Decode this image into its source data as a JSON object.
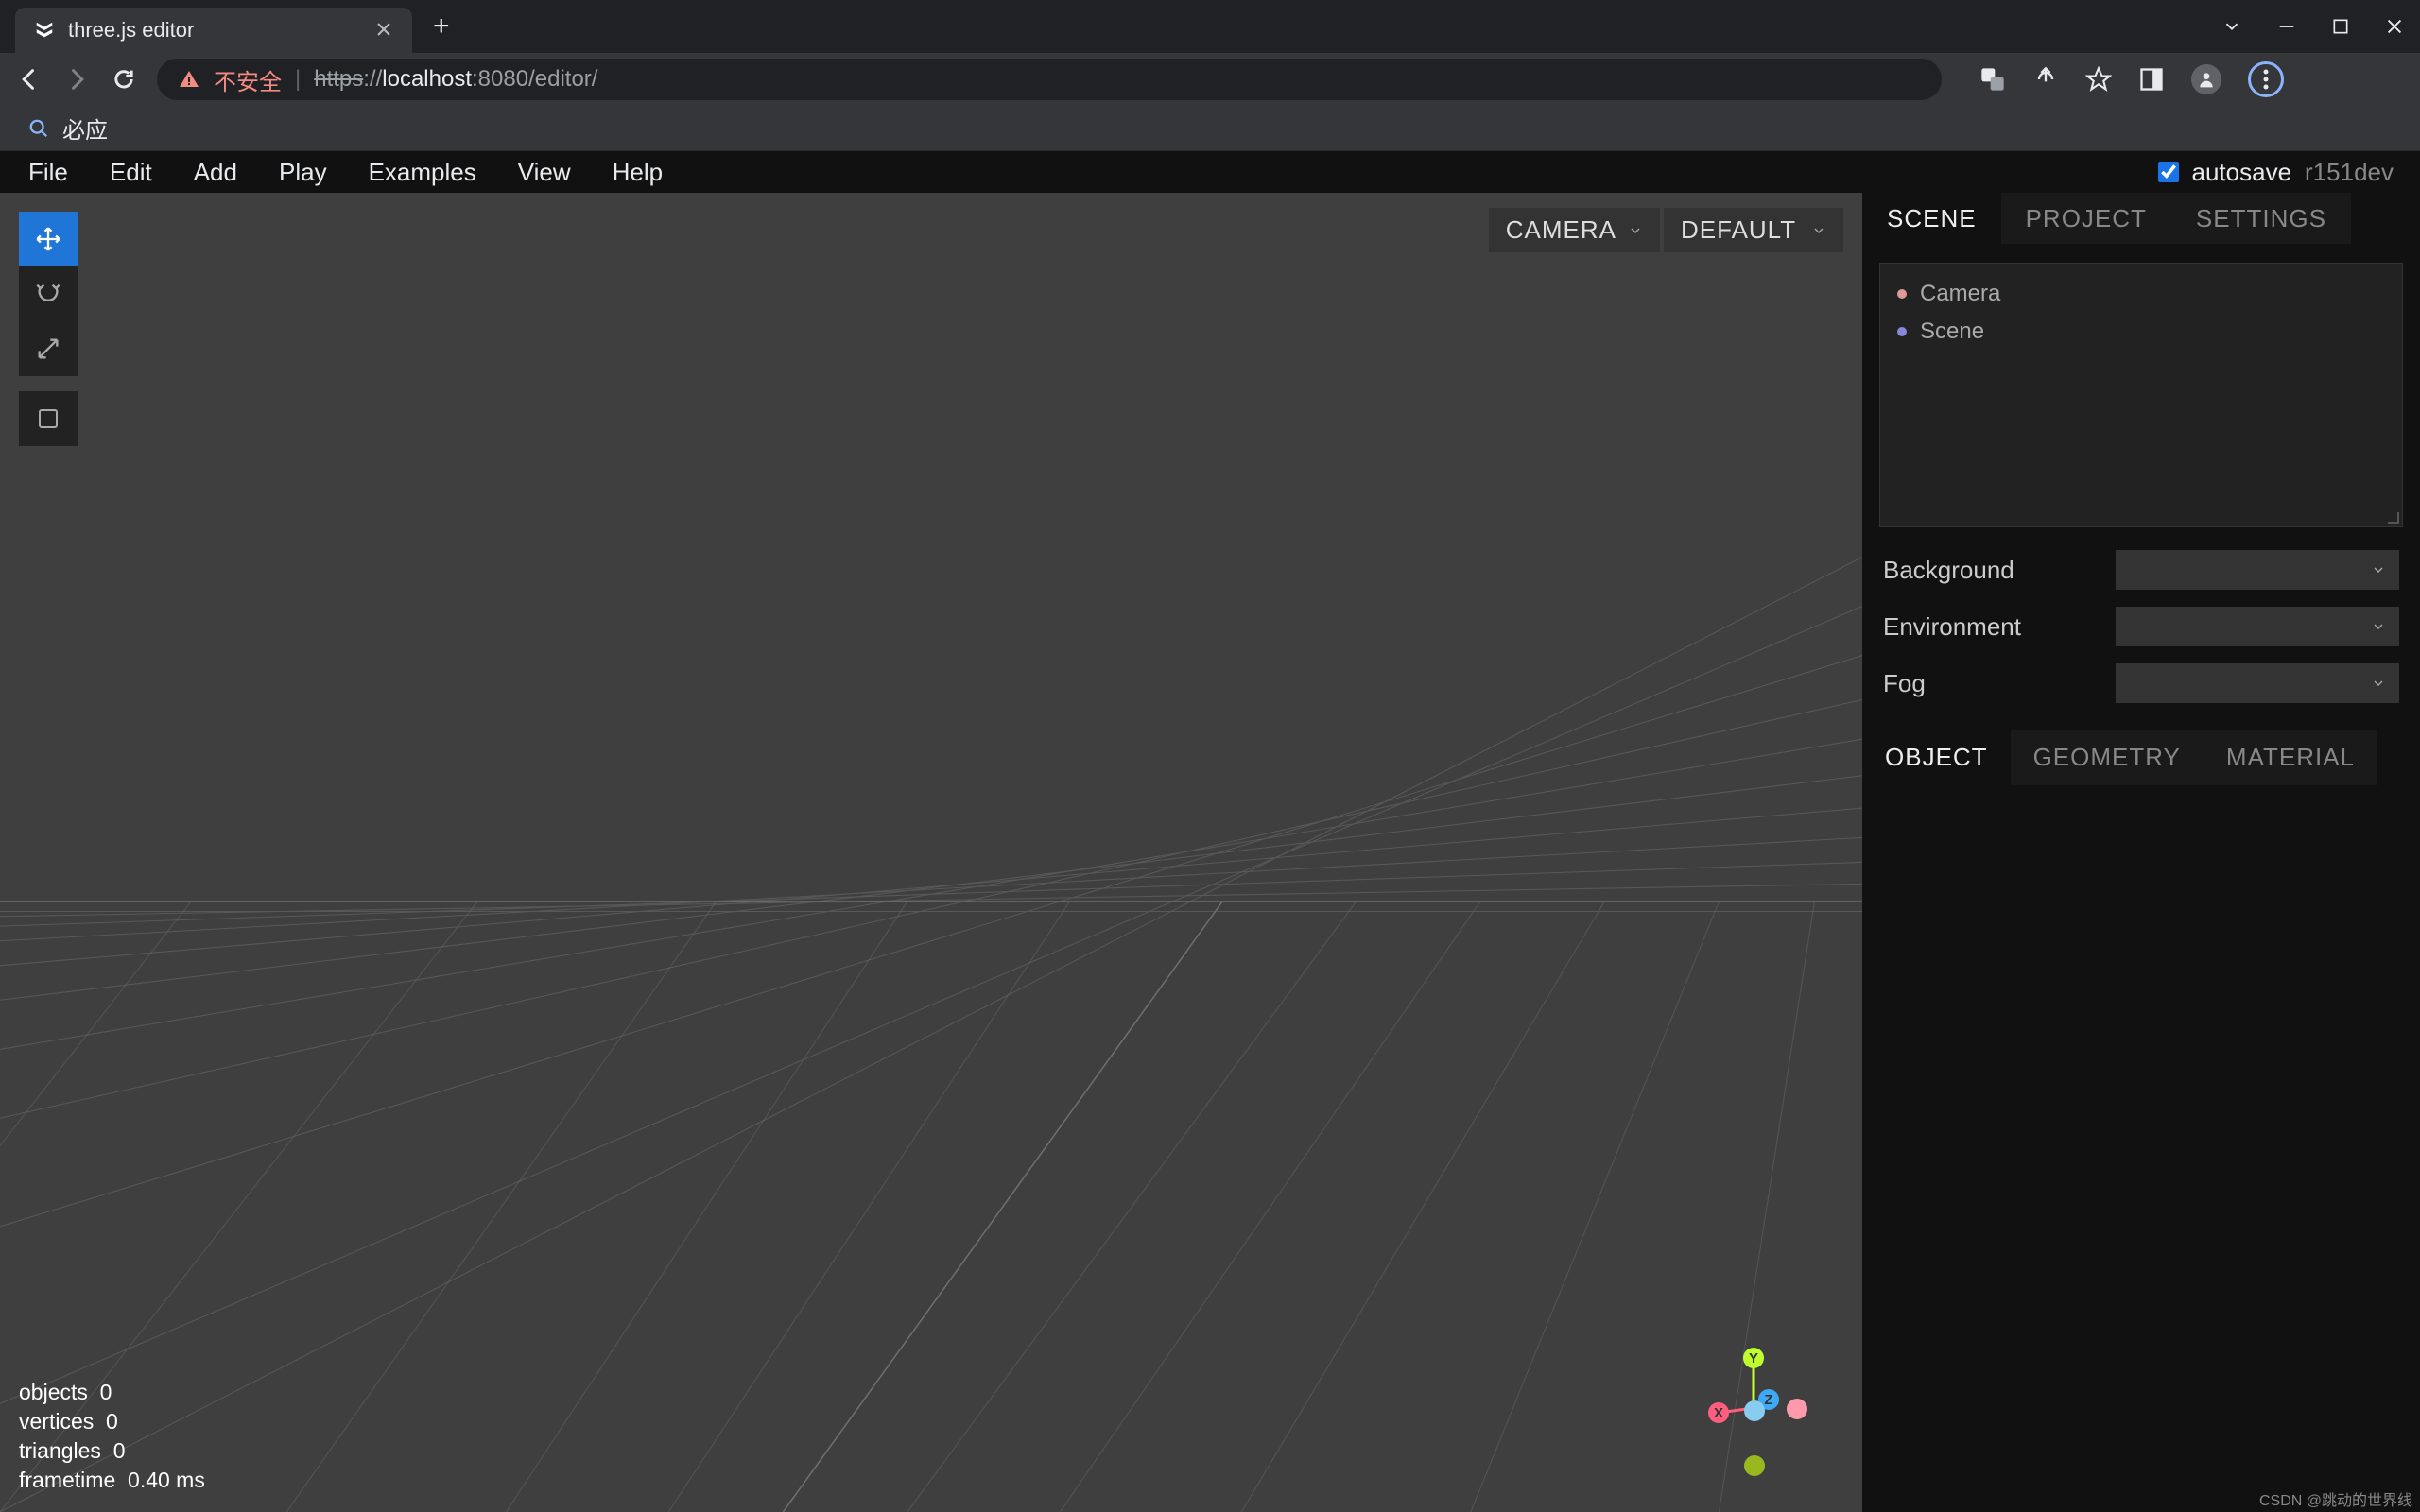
{
  "browser": {
    "tab_title": "three.js editor",
    "warn_text": "不安全",
    "url_proto": "https",
    "url_rest": "://",
    "url_host": "localhost",
    "url_port": ":8080",
    "url_path": "/editor/",
    "bookmark": "必应"
  },
  "menus": [
    "File",
    "Edit",
    "Add",
    "Play",
    "Examples",
    "View",
    "Help"
  ],
  "autosave_label": "autosave",
  "version": "r151dev",
  "viewport": {
    "camera_label": "CAMERA",
    "shading_label": "DEFAULT",
    "stats": {
      "objects_label": "objects",
      "objects": 0,
      "vertices_label": "vertices",
      "vertices": 0,
      "triangles_label": "triangles",
      "triangles": 0,
      "frametime_label": "frametime",
      "frametime": "0.40 ms"
    },
    "axes": {
      "x": "X",
      "y": "Y",
      "z": "Z"
    }
  },
  "sidebar": {
    "tabs": [
      "SCENE",
      "PROJECT",
      "SETTINGS"
    ],
    "outliner": [
      {
        "label": "Camera",
        "color": "#e09999"
      },
      {
        "label": "Scene",
        "color": "#8888dd"
      }
    ],
    "props": {
      "background": "Background",
      "environment": "Environment",
      "fog": "Fog"
    },
    "subtabs": [
      "OBJECT",
      "GEOMETRY",
      "MATERIAL"
    ]
  },
  "watermark": "CSDN @跳动的世界线"
}
